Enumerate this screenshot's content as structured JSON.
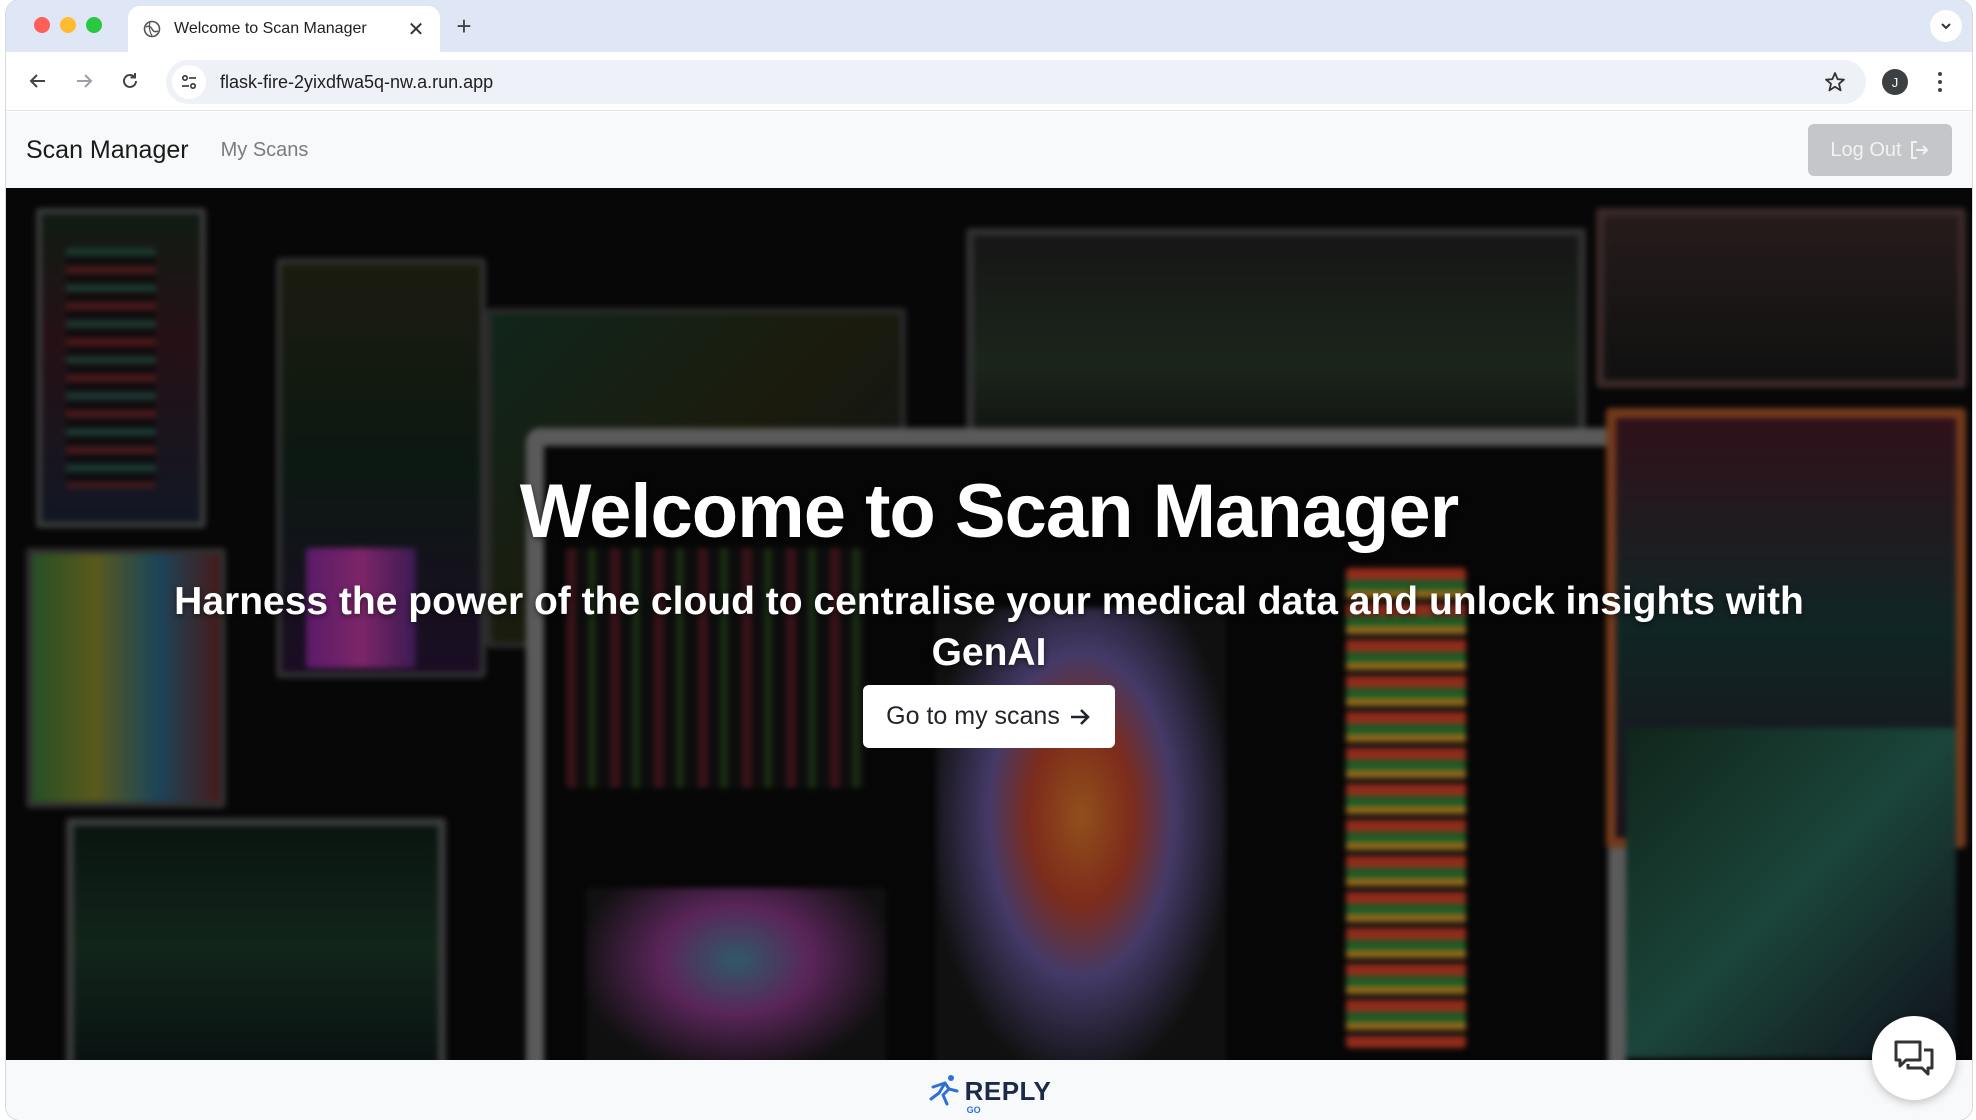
{
  "browser": {
    "tab_title": "Welcome to Scan Manager",
    "url": "flask-fire-2yixdfwa5q-nw.a.run.app",
    "profile_initial": "J",
    "new_tab_label": "+",
    "close_label": "✕"
  },
  "navbar": {
    "brand": "Scan Manager",
    "links": [
      "My Scans"
    ],
    "logout_label": "Log Out"
  },
  "hero": {
    "title": "Welcome to Scan Manager",
    "subtitle": "Harness the power of the cloud to centralise your medical data and unlock insights with GenAI",
    "button_label": "Go to my scans"
  },
  "footer": {
    "logo_text": "REPLY",
    "logo_subtext": "GO"
  },
  "icons": {
    "chat": "chat-bubbles-icon",
    "logout": "logout-arrow-icon"
  },
  "colors": {
    "navbar_bg": "#f8f9fa",
    "logout_bg": "#c4c6c9",
    "tabstrip_bg": "#dfe6f5",
    "reply_brand": "#1c2a4a"
  }
}
